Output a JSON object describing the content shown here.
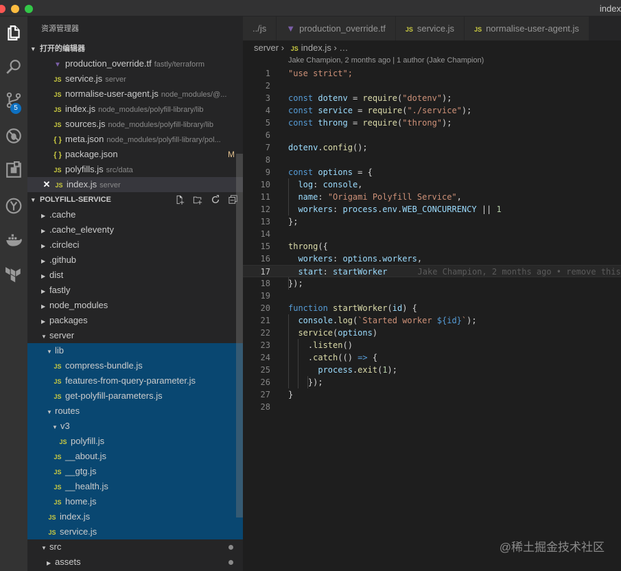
{
  "window": {
    "title": "index"
  },
  "activity_bar": {
    "icons": [
      "files-icon",
      "search-icon",
      "source-control-icon",
      "debug-icon",
      "extensions-icon",
      "git-lens-icon",
      "docker-icon",
      "terraform-icon"
    ],
    "scm_badge": "5"
  },
  "sidebar": {
    "title": "资源管理器",
    "open_editors": {
      "header": "打开的编辑器",
      "items": [
        {
          "icon": "terraform-icon",
          "name": "production_override.tf",
          "path": "fastly/terraform"
        },
        {
          "icon": "js-icon",
          "name": "service.js",
          "path": "server"
        },
        {
          "icon": "js-icon",
          "name": "normalise-user-agent.js",
          "path": "node_modules/@..."
        },
        {
          "icon": "js-icon",
          "name": "index.js",
          "path": "node_modules/polyfill-library/lib"
        },
        {
          "icon": "js-icon",
          "name": "sources.js",
          "path": "node_modules/polyfill-library/lib"
        },
        {
          "icon": "json-icon",
          "name": "meta.json",
          "path": "node_modules/polyfill-library/pol..."
        },
        {
          "icon": "json-icon",
          "name": "package.json",
          "path": "",
          "modified": "M"
        },
        {
          "icon": "js-icon",
          "name": "polyfills.js",
          "path": "src/data"
        },
        {
          "icon": "js-icon",
          "name": "index.js",
          "path": "server",
          "active": true
        }
      ]
    },
    "project": {
      "header": "POLYFILL-SERVICE",
      "tree": [
        {
          "name": ".cache",
          "type": "folder",
          "depth": 0,
          "open": false
        },
        {
          "name": ".cache_eleventy",
          "type": "folder",
          "depth": 0,
          "open": false
        },
        {
          "name": ".circleci",
          "type": "folder",
          "depth": 0,
          "open": false
        },
        {
          "name": ".github",
          "type": "folder",
          "depth": 0,
          "open": false
        },
        {
          "name": "dist",
          "type": "folder",
          "depth": 0,
          "open": false
        },
        {
          "name": "fastly",
          "type": "folder",
          "depth": 0,
          "open": false
        },
        {
          "name": "node_modules",
          "type": "folder",
          "depth": 0,
          "open": false
        },
        {
          "name": "packages",
          "type": "folder",
          "depth": 0,
          "open": false
        },
        {
          "name": "server",
          "type": "folder",
          "depth": 0,
          "open": true
        },
        {
          "name": "lib",
          "type": "folder",
          "depth": 1,
          "open": true,
          "selected": true
        },
        {
          "name": "compress-bundle.js",
          "type": "js",
          "depth": 2,
          "selected": true
        },
        {
          "name": "features-from-query-parameter.js",
          "type": "js",
          "depth": 2,
          "selected": true
        },
        {
          "name": "get-polyfill-parameters.js",
          "type": "js",
          "depth": 2,
          "selected": true
        },
        {
          "name": "routes",
          "type": "folder",
          "depth": 1,
          "open": true,
          "selected": true
        },
        {
          "name": "v3",
          "type": "folder",
          "depth": 2,
          "open": true,
          "selected": true
        },
        {
          "name": "polyfill.js",
          "type": "js",
          "depth": 3,
          "selected": true
        },
        {
          "name": "__about.js",
          "type": "js",
          "depth": 2,
          "selected": true
        },
        {
          "name": "__gtg.js",
          "type": "js",
          "depth": 2,
          "selected": true
        },
        {
          "name": "__health.js",
          "type": "js",
          "depth": 2,
          "selected": true
        },
        {
          "name": "home.js",
          "type": "js",
          "depth": 2,
          "selected": true
        },
        {
          "name": "index.js",
          "type": "js",
          "depth": 1,
          "selected": true
        },
        {
          "name": "service.js",
          "type": "js",
          "depth": 1,
          "selected": true
        },
        {
          "name": "src",
          "type": "folder",
          "depth": 0,
          "open": true,
          "dot": true
        },
        {
          "name": "assets",
          "type": "folder",
          "depth": 1,
          "open": false,
          "dot": true
        }
      ]
    }
  },
  "editor": {
    "tabs": [
      {
        "label": "../js",
        "icon": "none"
      },
      {
        "label": "production_override.tf",
        "icon": "terraform-icon"
      },
      {
        "label": "service.js",
        "icon": "js-icon"
      },
      {
        "label": "normalise-user-agent.js",
        "icon": "js-icon"
      }
    ],
    "breadcrumb": {
      "folder": "server",
      "sep": "›",
      "file": "index.js",
      "tail": "› …"
    },
    "blame_header": "Jake Champion, 2 months ago | 1 author (Jake Champion)",
    "current_line": 17,
    "inline_blame": "Jake Champion, 2 months ago • remove this",
    "lines": [
      "1",
      "2",
      "3",
      "4",
      "5",
      "6",
      "7",
      "8",
      "9",
      "10",
      "11",
      "12",
      "13",
      "14",
      "15",
      "16",
      "17",
      "18",
      "19",
      "20",
      "21",
      "22",
      "23",
      "24",
      "25",
      "26",
      "27",
      "28"
    ],
    "code": {
      "l1": "\"use strict\";",
      "l3_kw": "const",
      "l3_var": "dotenv",
      "l3_fn": "require",
      "l3_str": "\"dotenv\"",
      "l4_kw": "const",
      "l4_var": "service",
      "l4_fn": "require",
      "l4_str": "\"./service\"",
      "l5_kw": "const",
      "l5_var": "throng",
      "l5_fn": "require",
      "l5_str": "\"throng\"",
      "l7_obj": "dotenv",
      "l7_fn": "config",
      "l9_kw": "const",
      "l9_var": "options",
      "l10_key": "log",
      "l10_val": "console",
      "l11_key": "name",
      "l11_str": "\"Origami Polyfill Service\"",
      "l12_key": "workers",
      "l12_a": "process",
      "l12_b": "env",
      "l12_c": "WEB_CONCURRENCY",
      "l12_num": "1",
      "l15_fn": "throng",
      "l16_key": "workers",
      "l16_a": "options",
      "l16_b": "workers",
      "l17_key": "start",
      "l17_val": "startWorker",
      "l20_kw": "function",
      "l20_fn": "startWorker",
      "l20_arg": "id",
      "l21_obj": "console",
      "l21_fn": "log",
      "l21_str1": "`Started worker ",
      "l21_tpl": "${id}",
      "l21_str2": "`",
      "l22_fn": "service",
      "l22_arg": "options",
      "l23_fn": "listen",
      "l24_fn": "catch",
      "l25_obj": "process",
      "l25_fn": "exit",
      "l25_num": "1"
    }
  },
  "watermark": "@稀土掘金技术社区"
}
